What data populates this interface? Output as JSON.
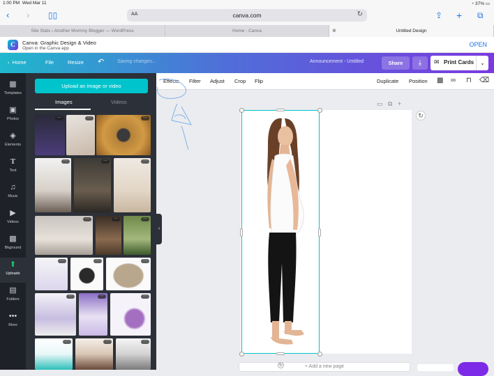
{
  "status_bar": {
    "time": "1:00 PM",
    "date": "Wed Mar 11",
    "battery": "37%"
  },
  "browser": {
    "url_aa": "AA",
    "url_host": "canva.com",
    "tabs": [
      {
        "label": "Site Stats ‹ Another Mommy Blogger — WordPress"
      },
      {
        "label": "Home - Canva"
      },
      {
        "label": "Untitled Design"
      }
    ]
  },
  "app_banner": {
    "title": "Canva: Graphic Design & Video",
    "subtitle": "Open in the Canva app",
    "open_label": "OPEN",
    "logo_letter": "C"
  },
  "header": {
    "home_label": "Home",
    "file_label": "File",
    "resize_label": "Resize",
    "saving_text": "Saving changes...",
    "doc_title": "Announcement - Untitled",
    "share_label": "Share",
    "print_label": "Print Cards"
  },
  "rail": {
    "items": [
      {
        "label": "Templates",
        "icon": "templates-icon"
      },
      {
        "label": "Photos",
        "icon": "photos-icon"
      },
      {
        "label": "Elements",
        "icon": "elements-icon"
      },
      {
        "label": "Text",
        "icon": "text-icon"
      },
      {
        "label": "Music",
        "icon": "music-icon"
      },
      {
        "label": "Videos",
        "icon": "videos-icon"
      },
      {
        "label": "Bkground",
        "icon": "background-icon"
      },
      {
        "label": "Uploads",
        "icon": "uploads-icon"
      },
      {
        "label": "Folders",
        "icon": "folders-icon"
      },
      {
        "label": "More",
        "icon": "more-icon"
      }
    ],
    "active": "Uploads"
  },
  "panel": {
    "upload_label": "Upload an image or video",
    "tab_images": "Images",
    "tab_videos": "Videos"
  },
  "toolbar": {
    "effects": "Effects",
    "filter": "Filter",
    "adjust": "Adjust",
    "crop": "Crop",
    "flip": "Flip",
    "duplicate": "Duplicate",
    "position": "Position"
  },
  "canvas": {
    "add_page_label": "+ Add a new page"
  },
  "colors": {
    "accent": "#00c4cc",
    "purple": "#7d2ae8",
    "rail_bg": "#1e2228",
    "panel_bg": "#2c3038",
    "uploads_green": "#19c96b"
  }
}
